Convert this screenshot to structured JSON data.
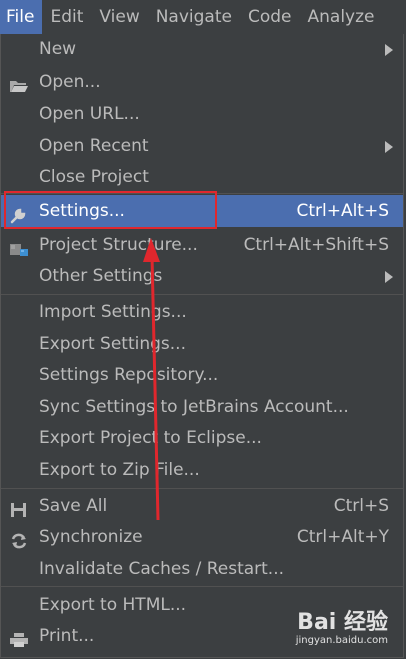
{
  "menubar": {
    "items": [
      "File",
      "Edit",
      "View",
      "Navigate",
      "Code",
      "Analyze"
    ]
  },
  "file_menu": {
    "items": [
      {
        "label": "New",
        "shortcut": "",
        "submenu": true,
        "icon": ""
      },
      {
        "label": "Open...",
        "shortcut": "",
        "submenu": false,
        "icon": "folder-open-icon"
      },
      {
        "label": "Open URL...",
        "shortcut": "",
        "submenu": false,
        "icon": ""
      },
      {
        "label": "Open Recent",
        "shortcut": "",
        "submenu": true,
        "icon": ""
      },
      {
        "label": "Close Project",
        "shortcut": "",
        "submenu": false,
        "icon": ""
      },
      {
        "label": "Settings...",
        "shortcut": "Ctrl+Alt+S",
        "submenu": false,
        "icon": "wrench-icon",
        "selected": true
      },
      {
        "label": "Project Structure...",
        "shortcut": "Ctrl+Alt+Shift+S",
        "submenu": false,
        "icon": "project-structure-icon"
      },
      {
        "label": "Other Settings",
        "shortcut": "",
        "submenu": true,
        "icon": ""
      },
      {
        "label": "Import Settings...",
        "shortcut": "",
        "submenu": false,
        "icon": ""
      },
      {
        "label": "Export Settings...",
        "shortcut": "",
        "submenu": false,
        "icon": ""
      },
      {
        "label": "Settings Repository...",
        "shortcut": "",
        "submenu": false,
        "icon": ""
      },
      {
        "label": "Sync Settings to JetBrains Account...",
        "shortcut": "",
        "submenu": false,
        "icon": ""
      },
      {
        "label": "Export Project to Eclipse...",
        "shortcut": "",
        "submenu": false,
        "icon": ""
      },
      {
        "label": "Export to Zip File...",
        "shortcut": "",
        "submenu": false,
        "icon": ""
      },
      {
        "label": "Save All",
        "shortcut": "Ctrl+S",
        "submenu": false,
        "icon": "save-icon"
      },
      {
        "label": "Synchronize",
        "shortcut": "Ctrl+Alt+Y",
        "submenu": false,
        "icon": "sync-icon"
      },
      {
        "label": "Invalidate Caches / Restart...",
        "shortcut": "",
        "submenu": false,
        "icon": ""
      },
      {
        "label": "Export to HTML...",
        "shortcut": "",
        "submenu": false,
        "icon": ""
      },
      {
        "label": "Print...",
        "shortcut": "",
        "submenu": false,
        "icon": "printer-icon"
      }
    ]
  },
  "watermark": {
    "main": "Bai 经验",
    "sub": "jingyan.baidu.com"
  },
  "colors": {
    "background": "#3c3f41",
    "selection": "#4b6eaf",
    "text": "#bbbbbb",
    "annotation": "#e0272d"
  }
}
